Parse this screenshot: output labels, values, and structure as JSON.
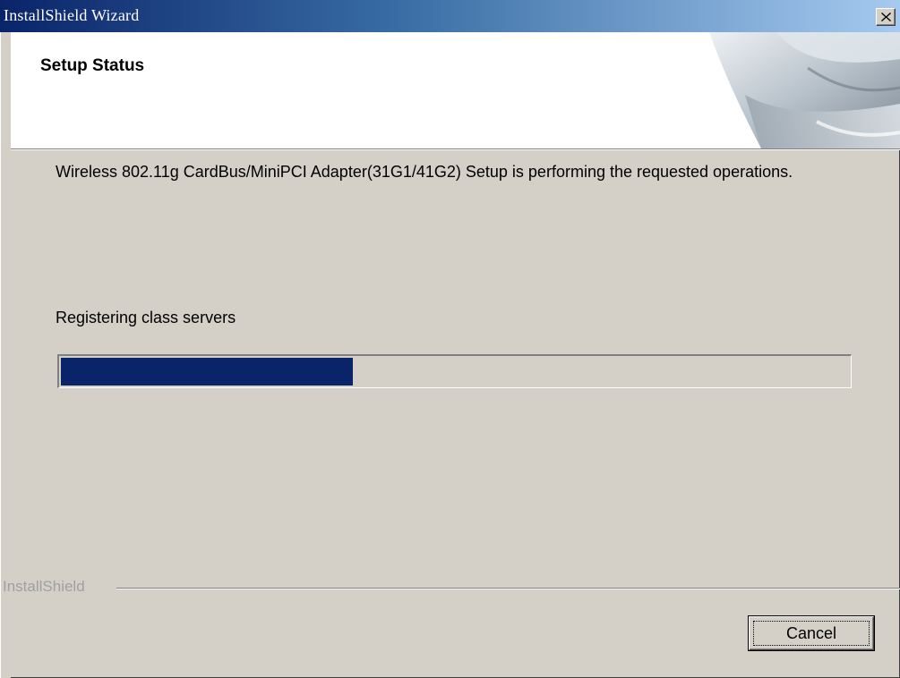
{
  "window": {
    "title": "InstallShield Wizard"
  },
  "header": {
    "title": "Setup Status"
  },
  "body": {
    "description": "Wireless 802.11g CardBus/MiniPCI Adapter(31G1/41G2) Setup is performing the requested operations.",
    "status": "Registering class servers"
  },
  "progress": {
    "fraction": 0.37
  },
  "footer": {
    "brand": "InstallShield",
    "cancel_label": "Cancel"
  },
  "colors": {
    "progress_fill": "#0a246a",
    "titlebar_start": "#0a246a",
    "titlebar_end": "#a6caf0",
    "dialog_bg": "#d4d0c8"
  },
  "icons": {
    "close": "close-icon",
    "header_graphic": "installshield-header-graphic"
  }
}
